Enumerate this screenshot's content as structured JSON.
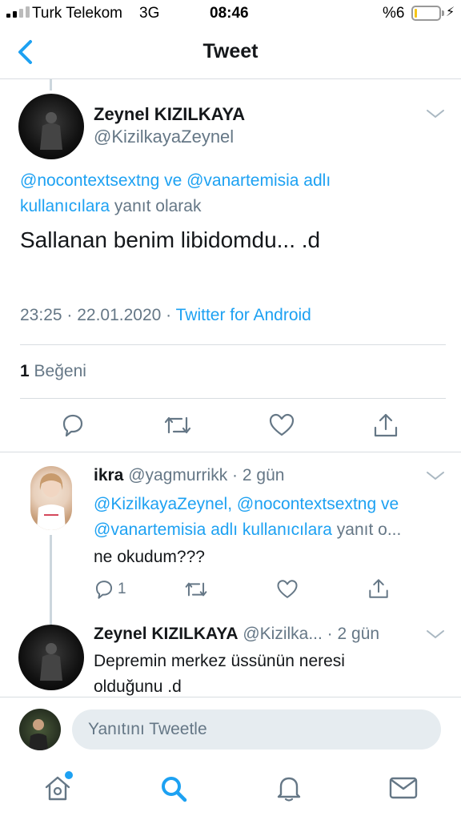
{
  "status_bar": {
    "carrier": "Turk Telekom",
    "network": "3G",
    "time": "08:46",
    "battery": "%6"
  },
  "header": {
    "title": "Tweet"
  },
  "tweet": {
    "author_name": "Zeynel KIZILKAYA",
    "author_handle": "@KizilkayaZeynel",
    "reply_mention_1": "@nocontextsextng ve @vanartemisia adlı",
    "reply_mention_2": "kullanıcılara",
    "reply_suffix": "yanıt olarak",
    "body": "Sallanan benim libidomdu... .d",
    "timestamp": "23:25 · 22.01.2020 · ",
    "source": "Twitter for Android",
    "likes_count": "1",
    "likes_label": "Beğeni"
  },
  "replies": [
    {
      "name": "ikra",
      "meta": "@yagmurrikk · 2 gün",
      "mention_line_1": "@KizilkayaZeynel, @nocontextsextng ve",
      "mention_line_2": "@vanartemisia adlı kullanıcılara",
      "mention_suffix": "yanıt o...",
      "body": "ne okudum???",
      "reply_count": "1"
    },
    {
      "name": "Zeynel KIZILKAYA",
      "meta": "@Kizilka... · 2 gün",
      "body_line_1": "Depremin merkez üssünün neresi",
      "body_line_2": "olduğunu .d"
    }
  ],
  "composer": {
    "placeholder": "Yanıtını Tweetle"
  },
  "tab_bar": [
    "home-icon",
    "search-icon",
    "notifications-icon",
    "messages-icon"
  ],
  "colors": {
    "accent": "#1da1f2",
    "secondary_text": "#657786",
    "divider": "#d8dde1"
  }
}
